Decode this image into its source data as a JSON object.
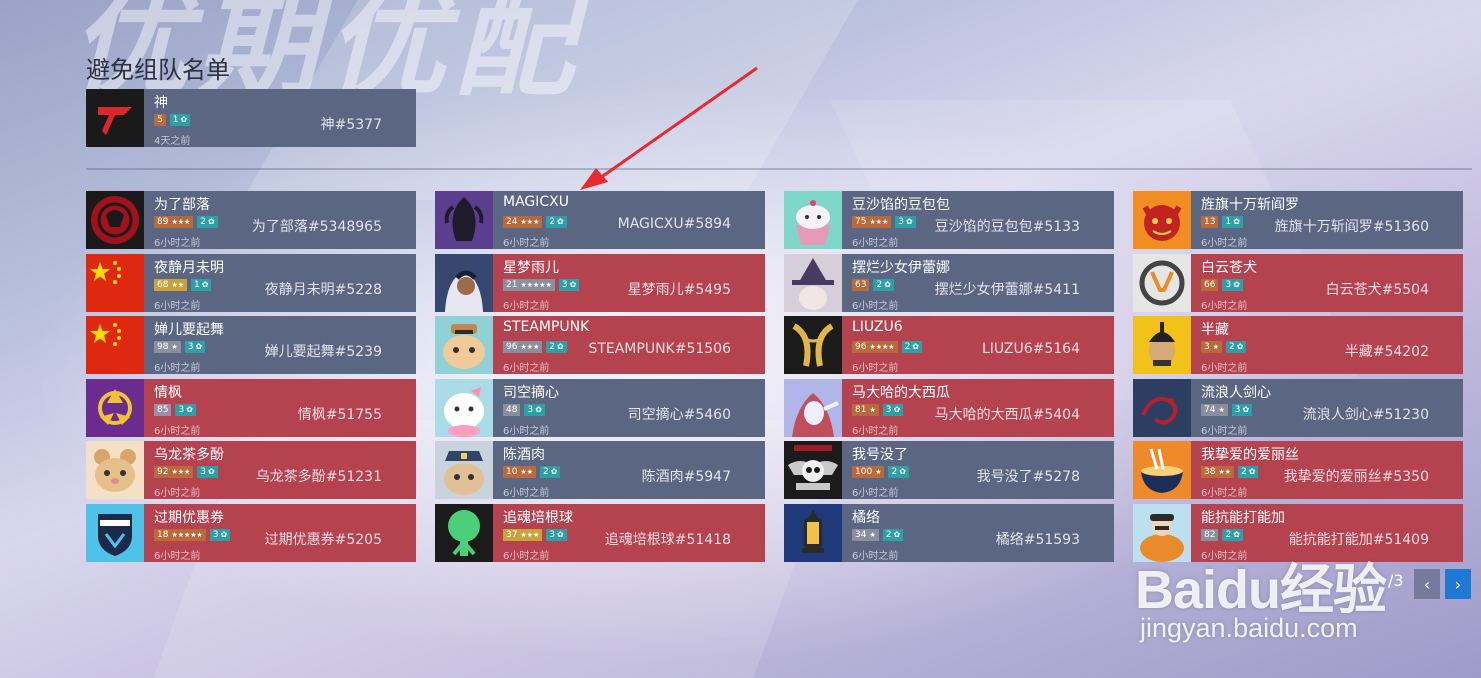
{
  "background_title": "优期优配",
  "section_title": "避免组队名单",
  "avoid_list": [
    {
      "name": "神",
      "level": "5",
      "endorse": "1",
      "time": "4天之前",
      "battletag": "神#5377",
      "color": "blue",
      "avatar": "red-logo"
    }
  ],
  "players": [
    [
      {
        "name": "为了部落",
        "level": "89",
        "stars": "★★★",
        "endorse": "2",
        "time": "6小时之前",
        "battletag": "为了部落#5348965",
        "color": "blue",
        "avatar": "horde-icon",
        "lvlcolor": "#b9693a"
      },
      {
        "name": "夜静月未明",
        "level": "68",
        "stars": "★★",
        "endorse": "1",
        "time": "6小时之前",
        "battletag": "夜静月未明#5228",
        "color": "blue",
        "avatar": "china-flag-icon",
        "lvlcolor": "#c9a33a"
      },
      {
        "name": "婵儿要起舞",
        "level": "98",
        "stars": "★",
        "endorse": "3",
        "time": "6小时之前",
        "battletag": "婵儿要起舞#5239",
        "color": "blue",
        "avatar": "china-flag-icon",
        "lvlcolor": "#8a8f9e"
      },
      {
        "name": "情枫",
        "level": "85",
        "stars": "",
        "endorse": "3",
        "time": "6小时之前",
        "battletag": "情枫#51755",
        "color": "red",
        "avatar": "purple-emblem-icon",
        "lvlcolor": "#9a8fa6"
      },
      {
        "name": "乌龙茶多酚",
        "level": "92",
        "stars": "★★★",
        "endorse": "3",
        "time": "6小时之前",
        "battletag": "乌龙茶多酚#51231",
        "color": "red",
        "avatar": "hamster-icon",
        "lvlcolor": "#b9693a"
      },
      {
        "name": "过期优惠券",
        "level": "18",
        "stars": "★★★★★",
        "endorse": "3",
        "time": "6小时之前",
        "battletag": "过期优惠券#5205",
        "color": "red",
        "avatar": "london-spitfire-icon",
        "lvlcolor": "#b9693a"
      }
    ],
    [
      {
        "name": "MAGICXU",
        "level": "24",
        "stars": "★★★",
        "endorse": "2",
        "time": "6小时之前",
        "battletag": "MAGICXU#5894",
        "color": "blue",
        "avatar": "widowmaker-icon",
        "lvlcolor": "#b9693a"
      },
      {
        "name": "星梦雨儿",
        "level": "21",
        "stars": "★★★★★",
        "endorse": "3",
        "time": "6小时之前",
        "battletag": "星梦雨儿#5495",
        "color": "red",
        "avatar": "ana-icon",
        "lvlcolor": "#8a8f9e"
      },
      {
        "name": "STEAMPUNK",
        "level": "96",
        "stars": "★★★",
        "endorse": "2",
        "time": "6小时之前",
        "battletag": "STEAMPUNK#51506",
        "color": "red",
        "avatar": "hamster-hat-icon",
        "lvlcolor": "#8a8f9e"
      },
      {
        "name": "司空摘心",
        "level": "48",
        "stars": "",
        "endorse": "3",
        "time": "6小时之前",
        "battletag": "司空摘心#5460",
        "color": "blue",
        "avatar": "white-pachimari-icon",
        "lvlcolor": "#8a8f9e"
      },
      {
        "name": "陈酒肉",
        "level": "10",
        "stars": "★★",
        "endorse": "2",
        "time": "6小时之前",
        "battletag": "陈酒肉#5947",
        "color": "blue",
        "avatar": "police-hamster-icon",
        "lvlcolor": "#b9693a"
      },
      {
        "name": "追魂培根球",
        "level": "37",
        "stars": "★★★",
        "endorse": "3",
        "time": "6小时之前",
        "battletag": "追魂培根球#51418",
        "color": "red",
        "avatar": "green-tree-icon",
        "lvlcolor": "#c9a33a"
      }
    ],
    [
      {
        "name": "豆沙馅的豆包包",
        "level": "75",
        "stars": "★★★",
        "endorse": "3",
        "time": "6小时之前",
        "battletag": "豆沙馅的豆包包#5133",
        "color": "blue",
        "avatar": "cupcake-icon",
        "lvlcolor": "#b9693a"
      },
      {
        "name": "摆烂少女伊蕾娜",
        "level": "63",
        "stars": "",
        "endorse": "2",
        "time": "6小时之前",
        "battletag": "摆烂少女伊蕾娜#5411",
        "color": "blue",
        "avatar": "witch-icon",
        "lvlcolor": "#b9693a"
      },
      {
        "name": "LIUZU6",
        "level": "96",
        "stars": "★★★★",
        "endorse": "2",
        "time": "6小时之前",
        "battletag": "LIUZU6#5164",
        "color": "red",
        "avatar": "gold-claws-icon",
        "lvlcolor": "#b9693a"
      },
      {
        "name": "马大哈的大西瓜",
        "level": "81",
        "stars": "★",
        "endorse": "3",
        "time": "6小时之前",
        "battletag": "马大哈的大西瓜#5404",
        "color": "red",
        "avatar": "elf-icon",
        "lvlcolor": "#b9693a"
      },
      {
        "name": "我号没了",
        "level": "100",
        "stars": "★",
        "endorse": "2",
        "time": "6小时之前",
        "battletag": "我号没了#5278",
        "color": "blue",
        "avatar": "skull-emblem-icon",
        "lvlcolor": "#b9693a"
      },
      {
        "name": "橘络",
        "level": "34",
        "stars": "★",
        "endorse": "2",
        "time": "6小时之前",
        "battletag": "橘络#51593",
        "color": "blue",
        "avatar": "lantern-icon",
        "lvlcolor": "#8a8f9e"
      }
    ],
    [
      {
        "name": "旌旗十万斩阎罗",
        "level": "13",
        "stars": "",
        "endorse": "1",
        "time": "6小时之前",
        "battletag": "旌旗十万斩阎罗#51360",
        "color": "blue",
        "avatar": "demon-icon",
        "lvlcolor": "#b9693a"
      },
      {
        "name": "白云苍犬",
        "level": "66",
        "stars": "",
        "endorse": "3",
        "time": "6小时之前",
        "battletag": "白云苍犬#5504",
        "color": "red",
        "avatar": "overwatch-logo-icon",
        "lvlcolor": "#b9693a"
      },
      {
        "name": "半藏",
        "level": "3",
        "stars": "★",
        "endorse": "2",
        "time": "6小时之前",
        "battletag": "半藏#54202",
        "color": "red",
        "avatar": "hanzo-icon",
        "lvlcolor": "#b9693a"
      },
      {
        "name": "流浪人剑心",
        "level": "74",
        "stars": "★",
        "endorse": "3",
        "time": "6小时之前",
        "battletag": "流浪人剑心#51230",
        "color": "blue",
        "avatar": "red-dragon-icon",
        "lvlcolor": "#8a8f9e"
      },
      {
        "name": "我挚爱的爱丽丝",
        "level": "38",
        "stars": "★★",
        "endorse": "2",
        "time": "6小时之前",
        "battletag": "我挚爱的爱丽丝#5350",
        "color": "red",
        "avatar": "ramen-icon",
        "lvlcolor": "#b9693a"
      },
      {
        "name": "能抗能打能加",
        "level": "82",
        "stars": "",
        "endorse": "2",
        "time": "6小时之前",
        "battletag": "能抗能打能加#51409",
        "color": "red",
        "avatar": "pumpkin-mei-icon",
        "lvlcolor": "#8a8f9e"
      }
    ]
  ],
  "pagination": {
    "label": "/3",
    "prev": "‹",
    "next": "›"
  },
  "watermark": {
    "logo": "Baidu经验",
    "url": "jingyan.baidu.com"
  }
}
